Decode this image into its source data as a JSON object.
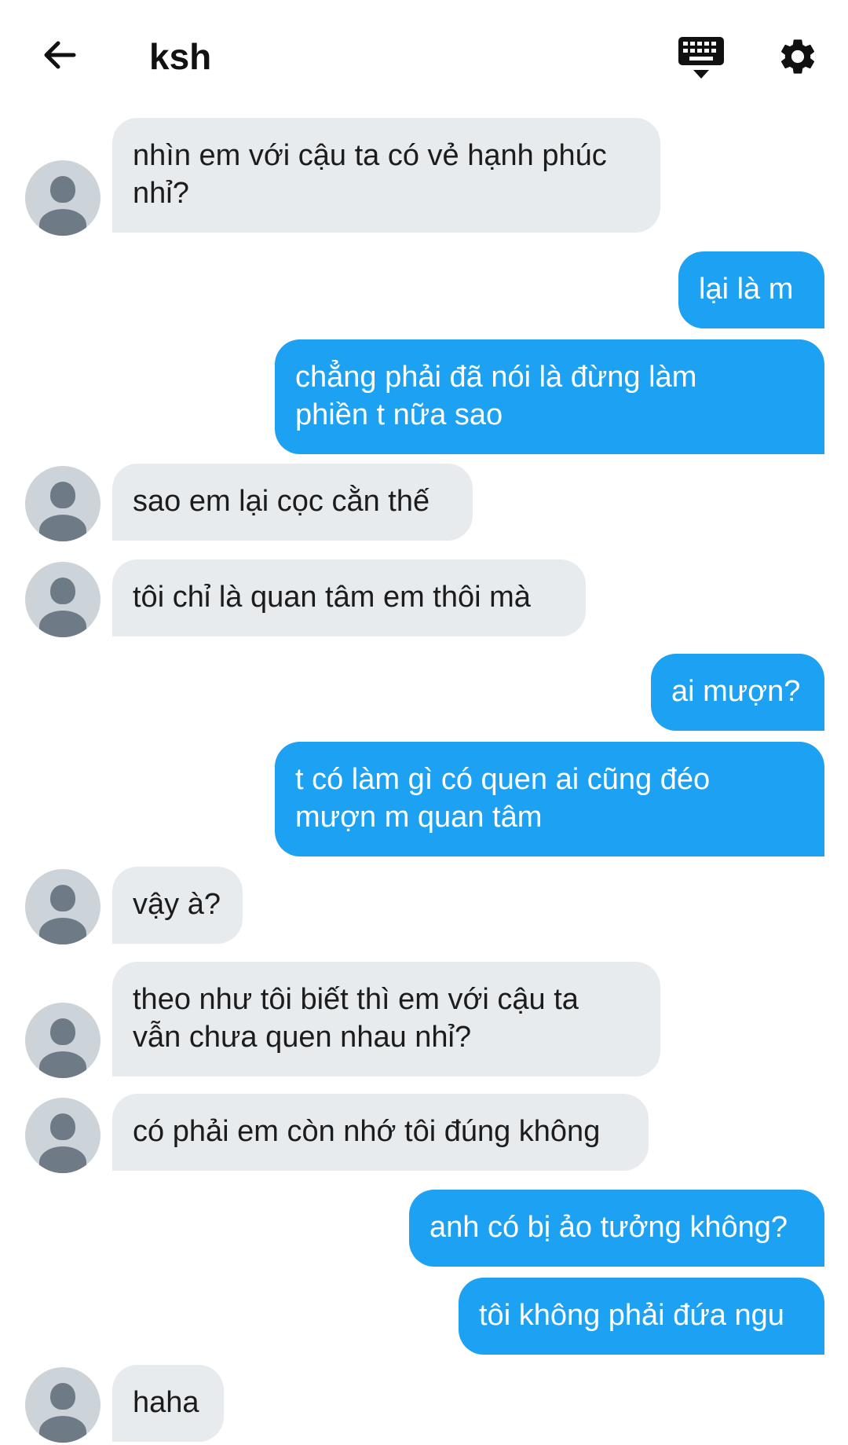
{
  "header": {
    "title": "ksh",
    "back_icon": "arrow-left-icon",
    "keyboard_icon": "keyboard-hide-icon",
    "settings_icon": "gear-icon"
  },
  "colors": {
    "outgoing_bubble": "#1da1f2",
    "incoming_bubble": "#e7ebee",
    "avatar_bg": "#ccd3d9",
    "avatar_fg": "#6e7a85"
  },
  "messages": [
    {
      "side": "in",
      "text": "nhìn em với cậu ta có vẻ hạnh phúc\nnhỉ?"
    },
    {
      "side": "out",
      "text": "lại là m"
    },
    {
      "side": "out",
      "text": "chẳng phải đã nói là đừng làm\nphiền t nữa sao"
    },
    {
      "side": "in",
      "text": "sao em lại cọc cằn thế"
    },
    {
      "side": "in",
      "text": "tôi chỉ là quan tâm em thôi mà"
    },
    {
      "side": "out",
      "text": "ai mượn?"
    },
    {
      "side": "out",
      "text": "t có làm gì có quen ai cũng đéo\nmượn m quan tâm"
    },
    {
      "side": "in",
      "text": "vậy à?"
    },
    {
      "side": "in",
      "text": "theo như tôi biết thì em với cậu ta\nvẫn chưa quen nhau nhỉ?"
    },
    {
      "side": "in",
      "text": "có phải em còn nhớ tôi đúng không"
    },
    {
      "side": "out",
      "text": "anh có bị ảo tưởng không?"
    },
    {
      "side": "out",
      "text": "tôi không phải đứa ngu"
    },
    {
      "side": "in",
      "text": "haha"
    }
  ]
}
